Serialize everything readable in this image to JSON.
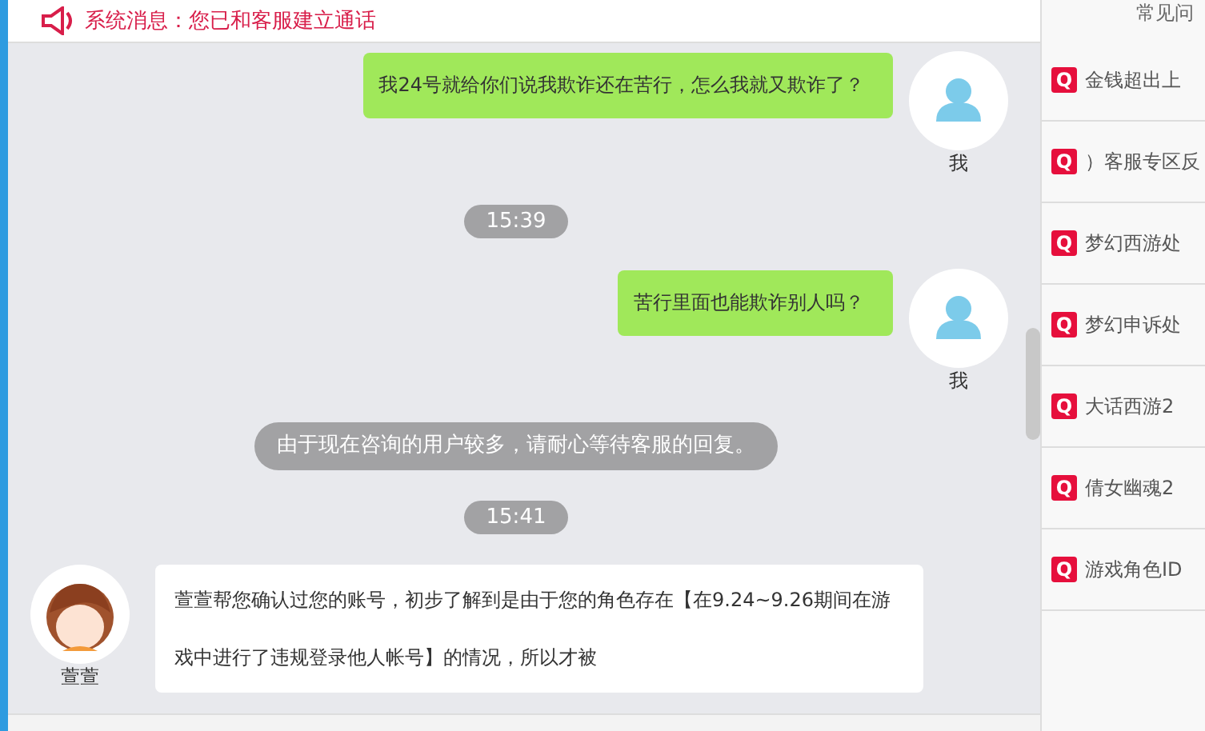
{
  "system_notice": {
    "text": "系统消息：您已和客服建立通话"
  },
  "messages": [
    {
      "kind": "user",
      "text": "我24号就给你们说我欺诈还在苦行，怎么我就又欺诈了？",
      "name": "我"
    },
    {
      "kind": "time",
      "text": "15:39"
    },
    {
      "kind": "user",
      "text": "苦行里面也能欺诈别人吗？",
      "name": "我"
    },
    {
      "kind": "notice",
      "text": "由于现在咨询的用户较多，请耐心等待客服的回复。"
    },
    {
      "kind": "time",
      "text": "15:41"
    },
    {
      "kind": "agent",
      "text": "萱萱帮您确认过您的账号，初步了解到是由于您的角色存在【在9.24~9.26期间在游戏中进行了违规登录他人帐号】的情况，所以才被",
      "name": "萱萱"
    }
  ],
  "faq": {
    "title": "常见问",
    "items": [
      {
        "badge": "Q",
        "text": "金钱超出上"
      },
      {
        "badge": "Q",
        "text": "）客服专区反"
      },
      {
        "badge": "Q",
        "text": "梦幻西游处"
      },
      {
        "badge": "Q",
        "text": "梦幻申诉处"
      },
      {
        "badge": "Q",
        "text": "大话西游2"
      },
      {
        "badge": "Q",
        "text": "倩女幽魂2"
      },
      {
        "badge": "Q",
        "text": "游戏角色ID"
      }
    ]
  }
}
